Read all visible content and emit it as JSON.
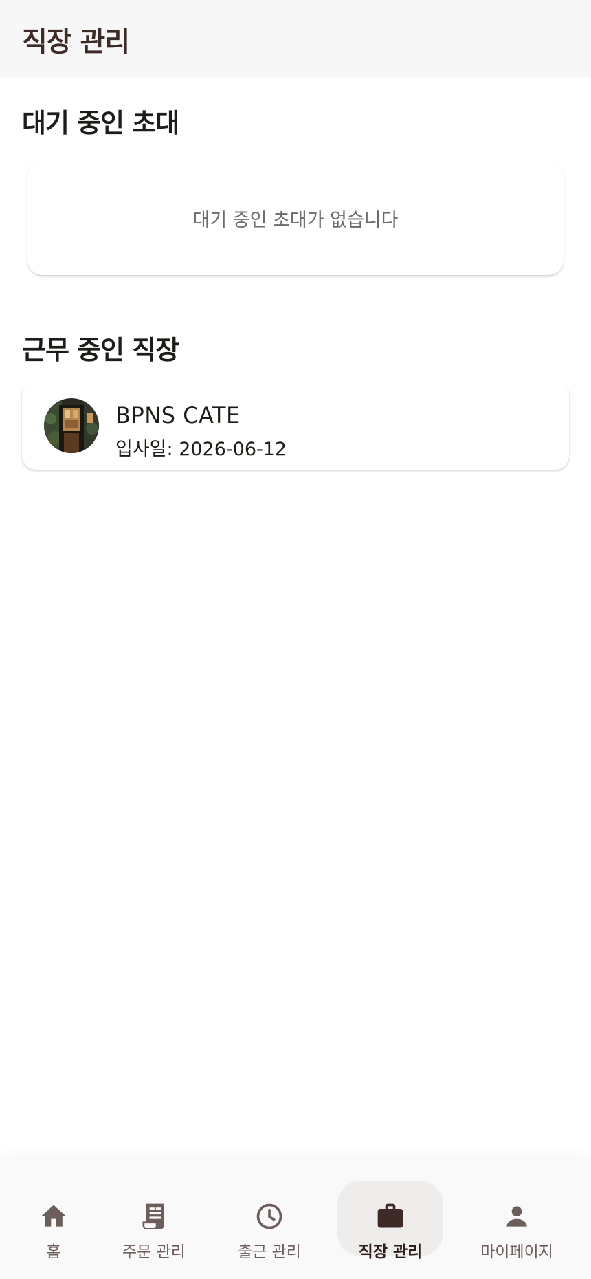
{
  "app_bar": {
    "title": "직장 관리"
  },
  "pending_invites": {
    "title": "대기 중인 초대",
    "empty_message": "대기 중인 초대가 없습니다"
  },
  "active_workplaces": {
    "title": "근무 중인 직장",
    "items": [
      {
        "name": "BPNS CATE",
        "join_date": "입사일: 2026-06-12"
      }
    ]
  },
  "bottom_nav": {
    "active_index": 3,
    "items": [
      {
        "label": "홈",
        "icon": "home-icon"
      },
      {
        "label": "주문 관리",
        "icon": "receipt-icon"
      },
      {
        "label": "출근 관리",
        "icon": "clock-icon"
      },
      {
        "label": "직장 관리",
        "icon": "briefcase-icon"
      },
      {
        "label": "마이페이지",
        "icon": "person-icon"
      }
    ]
  },
  "colors": {
    "primary": "#3e2a26",
    "nav_inactive": "#6d5e5c",
    "nav_indicator": "#efedec"
  }
}
